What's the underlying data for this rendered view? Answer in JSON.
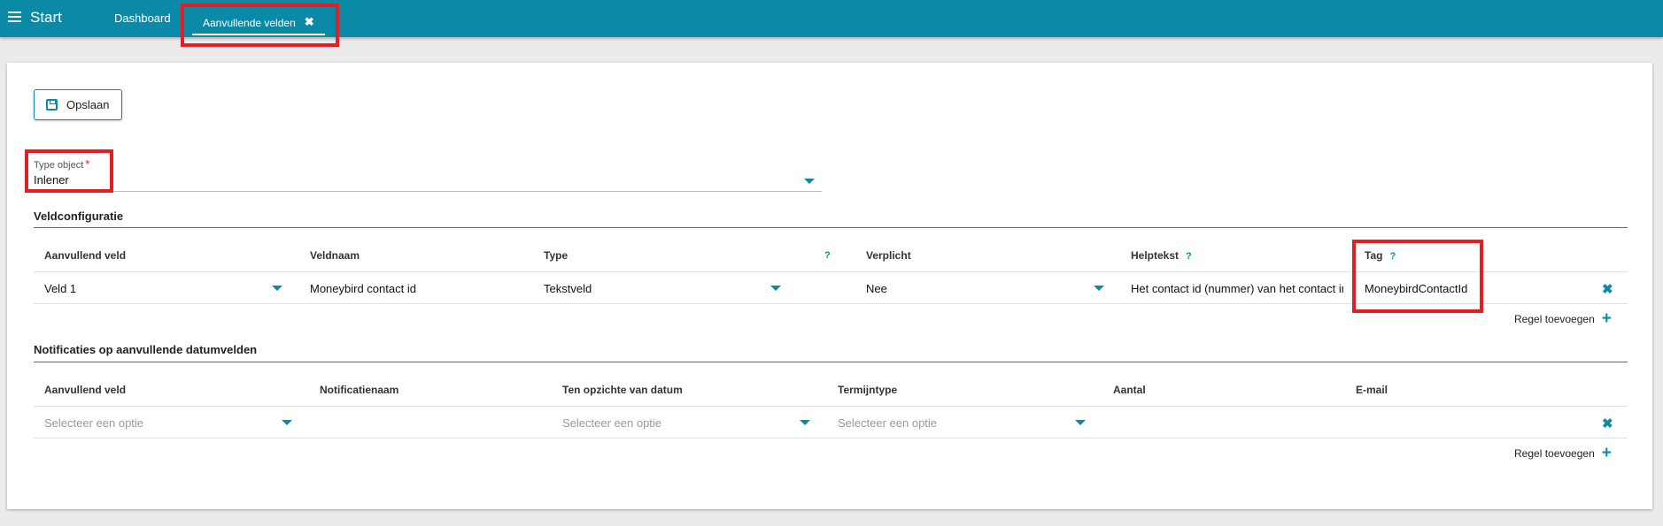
{
  "topbar": {
    "menu_icon": "hamburger-icon",
    "start_label": "Start",
    "tabs": [
      {
        "label": "Dashboard"
      },
      {
        "label": "Aanvullende velden",
        "close_icon": "close-icon"
      }
    ]
  },
  "toolbar": {
    "save_label": "Opslaan",
    "save_icon": "floppy-disk-icon"
  },
  "type_object": {
    "label": "Type object",
    "required_mark": "*",
    "value": "Inlener"
  },
  "veldconfiguratie": {
    "title": "Veldconfiguratie",
    "columns": [
      "Aanvullend veld",
      "Veldnaam",
      "Type",
      "?",
      "Verplicht",
      "Helptekst",
      "Tag"
    ],
    "help_mark": "?",
    "rows": [
      {
        "aanvullend_veld": "Veld 1",
        "veldnaam": "Moneybird contact id",
        "type": "Tekstveld",
        "verplicht": "Nee",
        "helptekst": "Het contact id (nummer) van het contact in",
        "tag": "MoneybirdContactId"
      }
    ],
    "add_label": "Regel toevoegen"
  },
  "notificaties": {
    "title": "Notificaties op aanvullende datumvelden",
    "columns": [
      "Aanvullend veld",
      "Notificatienaam",
      "Ten opzichte van datum",
      "Termijntype",
      "Aantal",
      "E-mail"
    ],
    "rows": [
      {
        "aanvullend_veld_placeholder": "Selecteer een optie",
        "ten_opzichte_placeholder": "Selecteer een optie",
        "termijntype_placeholder": "Selecteer een optie"
      }
    ],
    "add_label": "Regel toevoegen"
  },
  "colors": {
    "accent": "#0b8aa8",
    "highlight": "#e31e24",
    "background": "#ebebeb"
  }
}
